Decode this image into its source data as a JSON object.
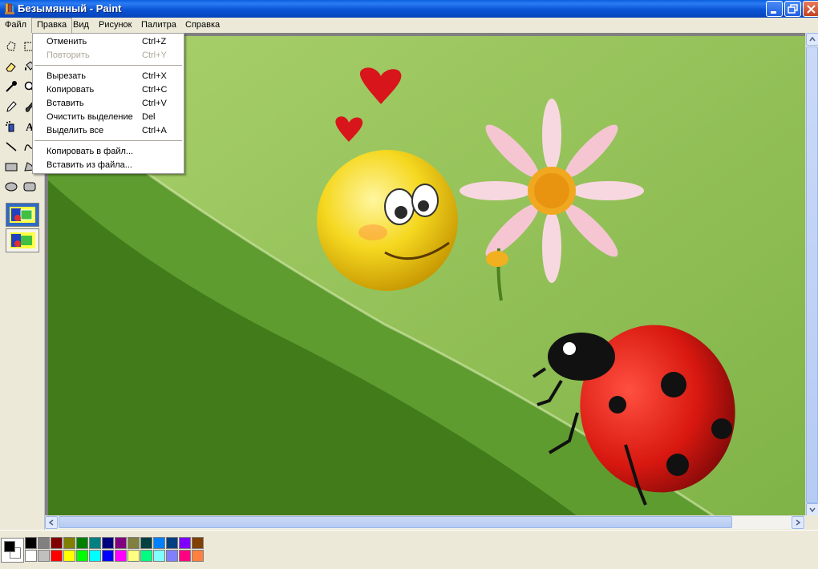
{
  "window": {
    "title": "Безымянный - Paint",
    "buttons": [
      "minimize",
      "maximize",
      "close"
    ]
  },
  "menubar": {
    "items": [
      "Файл",
      "Правка",
      "Вид",
      "Рисунок",
      "Палитра",
      "Справка"
    ],
    "active": "Правка"
  },
  "edit_menu": {
    "items": [
      {
        "label": "Отменить",
        "shortcut": "Ctrl+Z",
        "enabled": true
      },
      {
        "label": "Повторить",
        "shortcut": "Ctrl+Y",
        "enabled": false
      },
      {
        "label": "Вырезать",
        "shortcut": "Ctrl+X",
        "enabled": true
      },
      {
        "label": "Копировать",
        "shortcut": "Ctrl+C",
        "enabled": true
      },
      {
        "label": "Вставить",
        "shortcut": "Ctrl+V",
        "enabled": true
      },
      {
        "label": "Очистить выделение",
        "shortcut": "Del",
        "enabled": true
      },
      {
        "label": "Выделить все",
        "shortcut": "Ctrl+A",
        "enabled": true
      },
      {
        "label": "Копировать в файл...",
        "shortcut": "",
        "enabled": true
      },
      {
        "label": "Вставить из файла...",
        "shortcut": "",
        "enabled": true
      }
    ]
  },
  "toolbox": {
    "tools": [
      "free-select-icon",
      "rect-select-icon",
      "eraser-icon",
      "fill-icon",
      "color-picker-icon",
      "magnifier-icon",
      "pencil-icon",
      "brush-icon",
      "airbrush-icon",
      "text-icon",
      "line-icon",
      "curve-icon",
      "rectangle-icon",
      "polygon-icon",
      "ellipse-icon",
      "rounded-rect-icon"
    ]
  },
  "palette": {
    "foreground": "#000000",
    "background": "#ffffff",
    "colors": [
      "#000000",
      "#808080",
      "#800000",
      "#808000",
      "#008000",
      "#008080",
      "#000080",
      "#800080",
      "#808040",
      "#004040",
      "#0080ff",
      "#004080",
      "#8000ff",
      "#804000",
      "#ffffff",
      "#c0c0c0",
      "#ff0000",
      "#ffff00",
      "#00ff00",
      "#00ffff",
      "#0000ff",
      "#ff00ff",
      "#ffff80",
      "#00ff80",
      "#80ffff",
      "#8080ff",
      "#ff0080",
      "#ff8040"
    ]
  }
}
